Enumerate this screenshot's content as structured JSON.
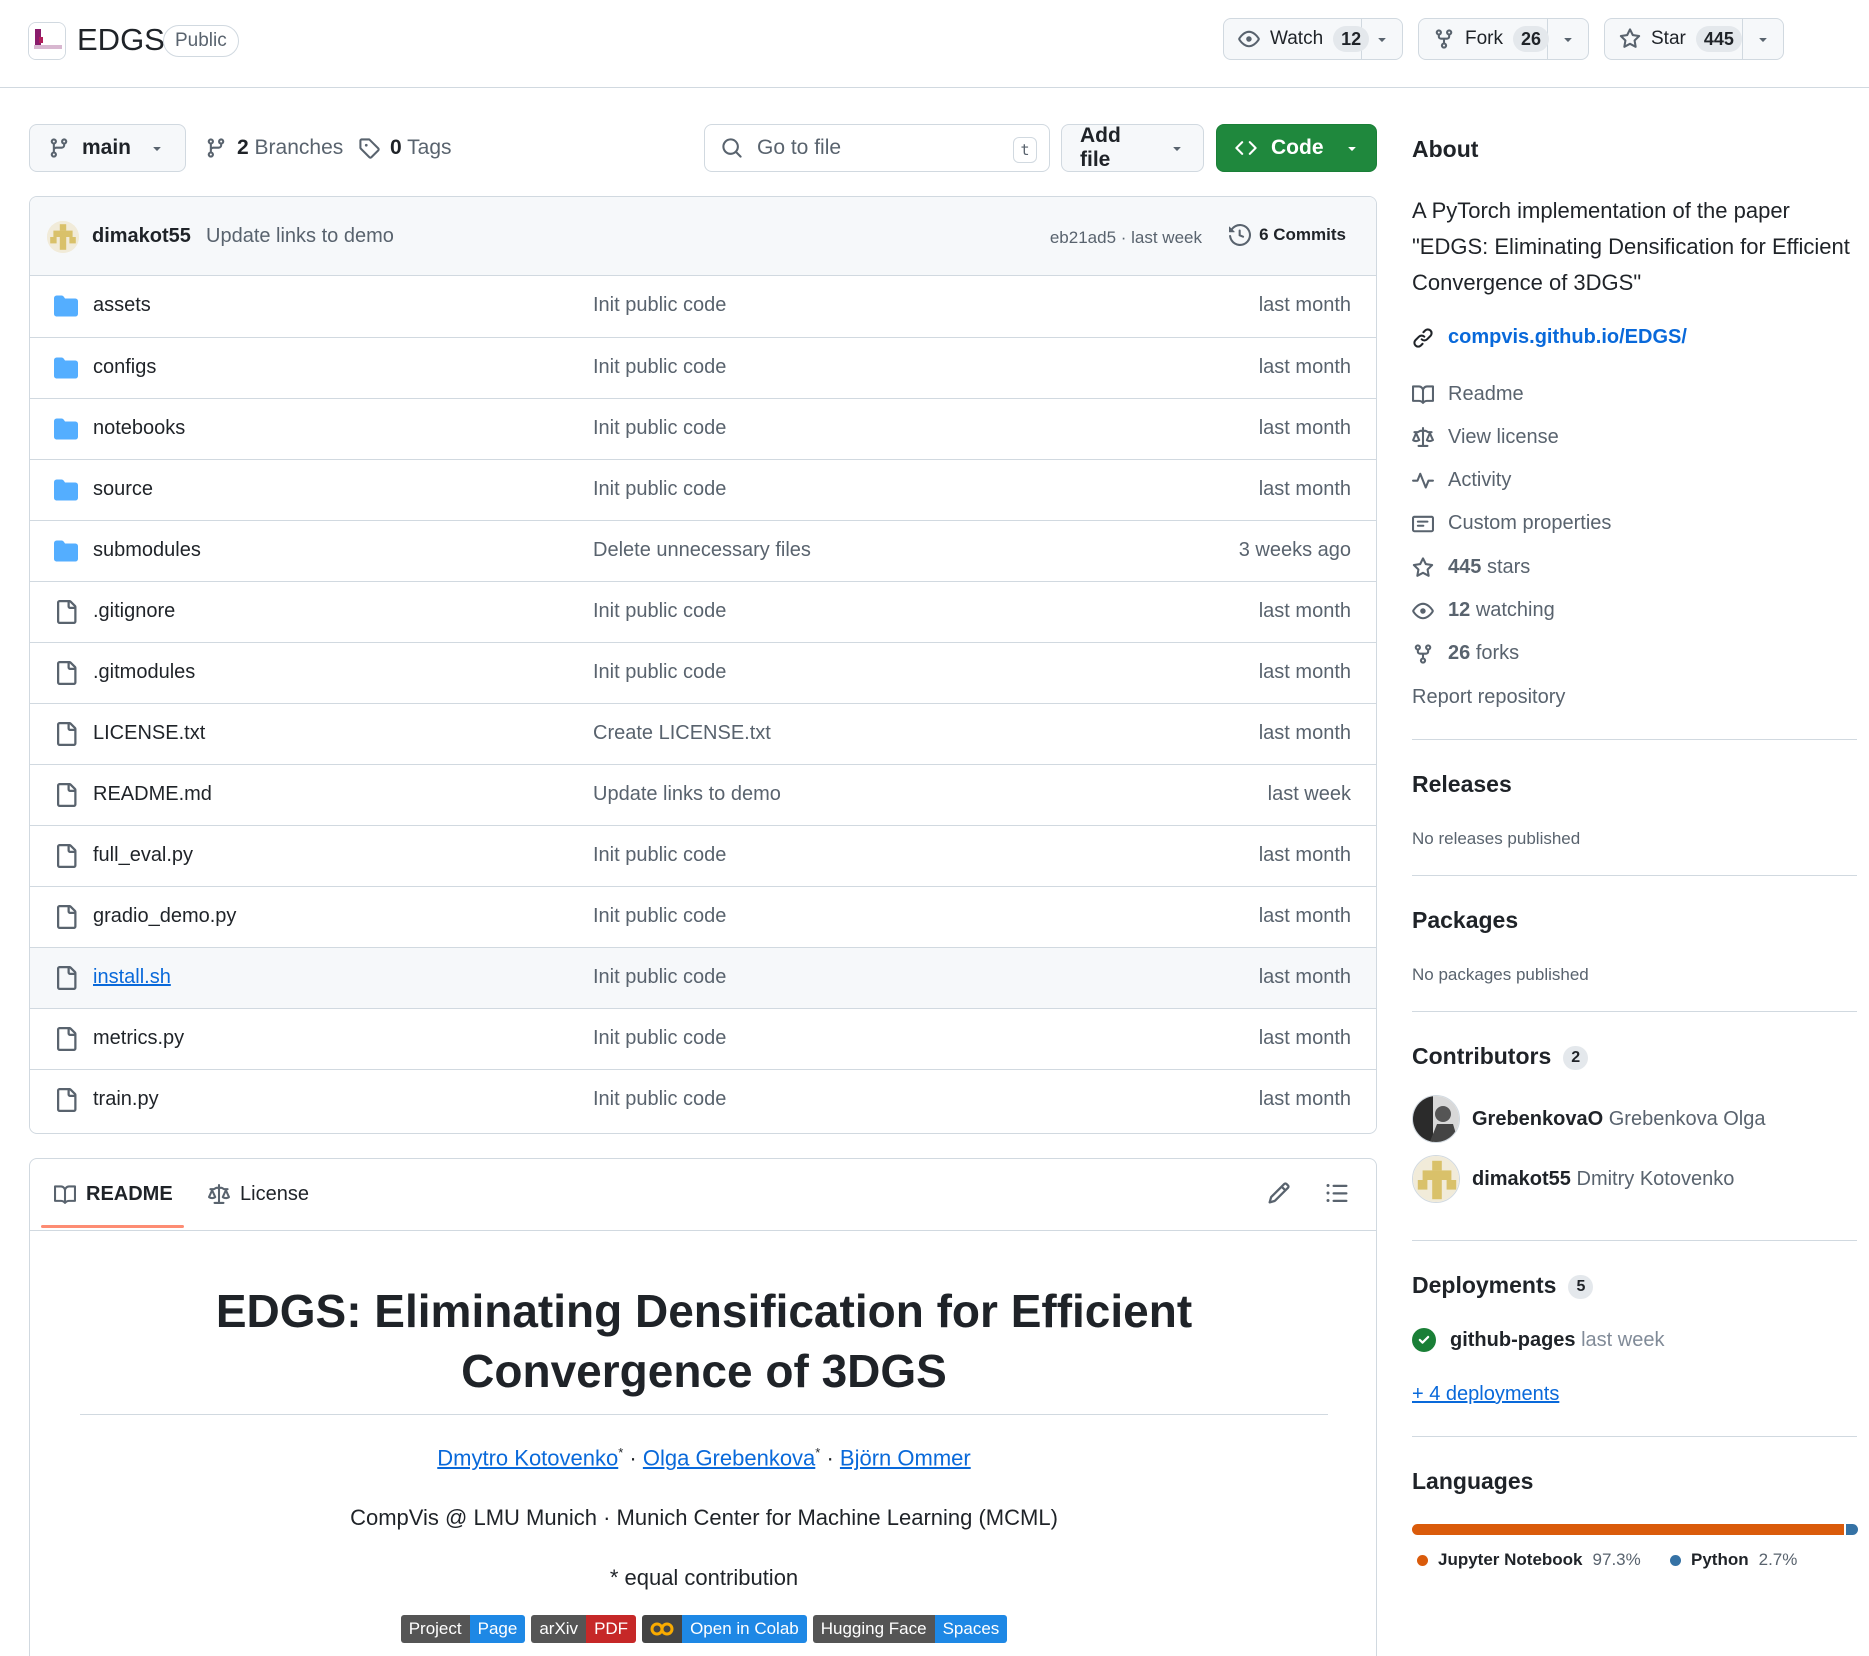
{
  "header": {
    "repo_name": "EDGS",
    "visibility": "Public",
    "watch": {
      "label": "Watch",
      "count": "12"
    },
    "fork": {
      "label": "Fork",
      "count": "26"
    },
    "star": {
      "label": "Star",
      "count": "445"
    }
  },
  "toolbar": {
    "branch": "main",
    "branches_count": "2",
    "branches_label": "Branches",
    "tags_count": "0",
    "tags_label": "Tags",
    "goto_placeholder": "Go to file",
    "goto_shortcut": "t",
    "add_file": "Add file",
    "code": "Code"
  },
  "commit": {
    "author": "dimakot55",
    "message": "Update links to demo",
    "hash_time": "eb21ad5 · last week",
    "commits_label": "6 Commits"
  },
  "files": [
    {
      "name": "assets",
      "type": "dir",
      "message": "Init public code",
      "date": "last month"
    },
    {
      "name": "configs",
      "type": "dir",
      "message": "Init public code",
      "date": "last month"
    },
    {
      "name": "notebooks",
      "type": "dir",
      "message": "Init public code",
      "date": "last month"
    },
    {
      "name": "source",
      "type": "dir",
      "message": "Init public code",
      "date": "last month"
    },
    {
      "name": "submodules",
      "type": "dir",
      "message": "Delete unnecessary files",
      "date": "3 weeks ago"
    },
    {
      "name": ".gitignore",
      "type": "file",
      "message": "Init public code",
      "date": "last month"
    },
    {
      "name": ".gitmodules",
      "type": "file",
      "message": "Init public code",
      "date": "last month"
    },
    {
      "name": "LICENSE.txt",
      "type": "file",
      "message": "Create LICENSE.txt",
      "date": "last month"
    },
    {
      "name": "README.md",
      "type": "file",
      "message": "Update links to demo",
      "date": "last week"
    },
    {
      "name": "full_eval.py",
      "type": "file",
      "message": "Init public code",
      "date": "last month"
    },
    {
      "name": "gradio_demo.py",
      "type": "file",
      "message": "Init public code",
      "date": "last month"
    },
    {
      "name": "install.sh",
      "type": "file",
      "message": "Init public code",
      "date": "last month"
    },
    {
      "name": "metrics.py",
      "type": "file",
      "message": "Init public code",
      "date": "last month"
    },
    {
      "name": "train.py",
      "type": "file",
      "message": "Init public code",
      "date": "last month"
    }
  ],
  "readme": {
    "tab_readme": "README",
    "tab_license": "License",
    "title_line1": "EDGS: Eliminating Densification for Efficient",
    "title_line2": "Convergence of 3DGS",
    "author1": "Dmytro Kotovenko",
    "author2": "Olga Grebenkova",
    "author3": "Björn Ommer",
    "star_mark": "*",
    "separator": " · ",
    "affiliation": "CompVis @ LMU Munich · Munich Center for Machine Learning (MCML)",
    "equal": "* equal contribution",
    "badges": [
      {
        "left": "Project",
        "right": "Page",
        "left_color": "#555555",
        "right_color": "#1e88e5"
      },
      {
        "left": "arXiv",
        "right": "PDF",
        "left_color": "#555555",
        "right_color": "#c62828"
      },
      {
        "left": "",
        "right": "Open in Colab",
        "left_color": "#444444",
        "right_color": "#1e88e5"
      },
      {
        "left": "Hugging Face",
        "right": "Spaces",
        "left_color": "#555555",
        "right_color": "#1e88e5"
      }
    ]
  },
  "about": {
    "heading": "About",
    "description": "A PyTorch implementation of the paper \"EDGS: Eliminating Densification for Efficient Convergence of 3DGS\"",
    "homepage": "compvis.github.io/EDGS/",
    "readme": "Readme",
    "license": "View license",
    "activity": "Activity",
    "custom_properties": "Custom properties",
    "stars_count": "445",
    "stars_label": "stars",
    "watching_count": "12",
    "watching_label": "watching",
    "forks_count": "26",
    "forks_label": "forks",
    "report": "Report repository"
  },
  "releases": {
    "heading": "Releases",
    "empty": "No releases published"
  },
  "packages": {
    "heading": "Packages",
    "empty": "No packages published"
  },
  "contributors": {
    "heading": "Contributors",
    "count": "2",
    "list": [
      {
        "login": "GrebenkovaO",
        "name": "Grebenkova Olga"
      },
      {
        "login": "dimakot55",
        "name": "Dmitry Kotovenko"
      }
    ]
  },
  "deployments": {
    "heading": "Deployments",
    "count": "5",
    "env": "github-pages",
    "time": "last week",
    "more": "+ 4 deployments"
  },
  "languages": {
    "heading": "Languages",
    "items": [
      {
        "name": "Jupyter Notebook",
        "percent": "97.3%",
        "value": 97.3,
        "color": "#DA5B0B"
      },
      {
        "name": "Python",
        "percent": "2.7%",
        "value": 2.7,
        "color": "#3572A5"
      }
    ]
  }
}
